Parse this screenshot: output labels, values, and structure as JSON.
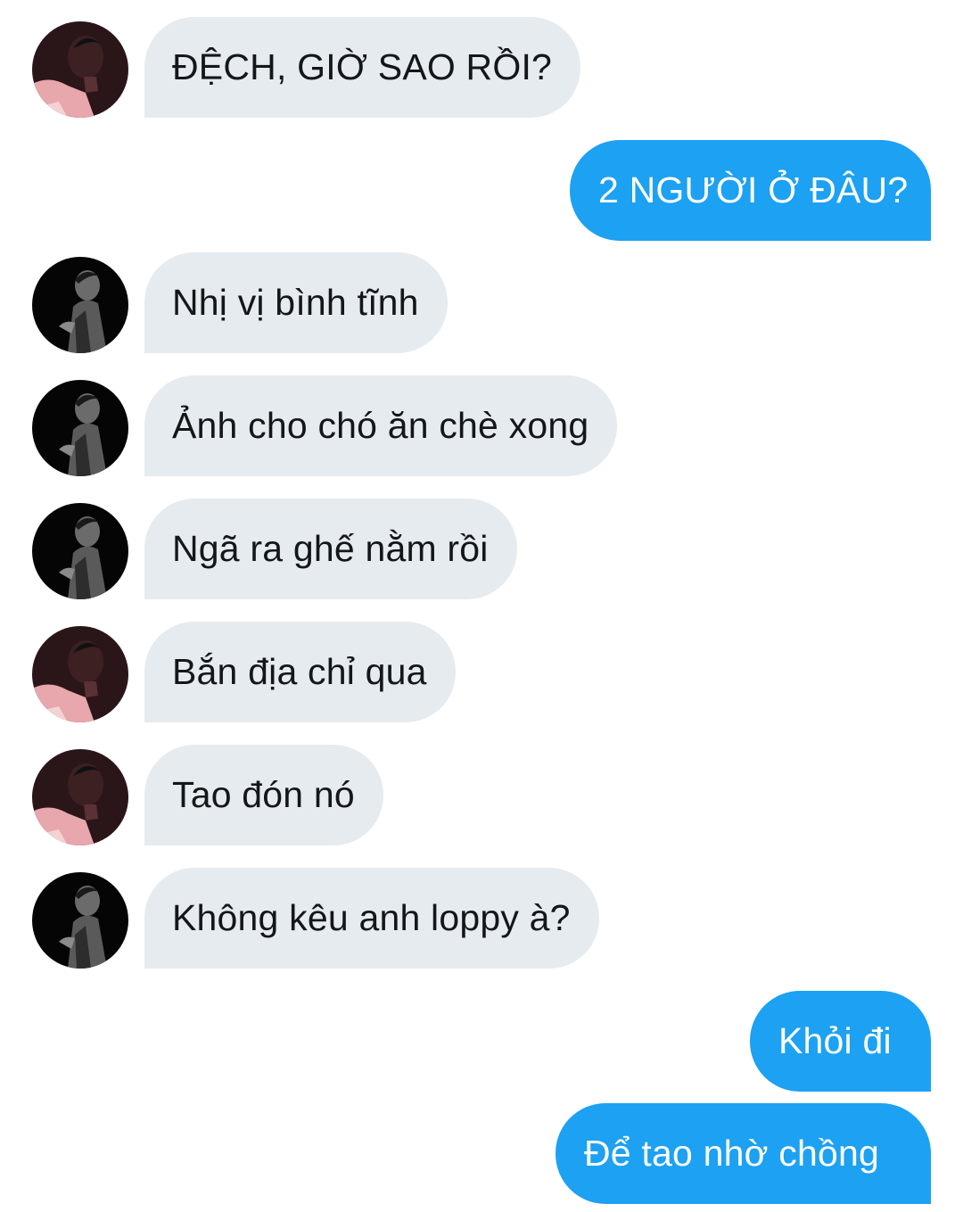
{
  "colors": {
    "incoming_bubble": "#e6ebf0",
    "outgoing_bubble": "#1da1f2",
    "incoming_text": "#14171a",
    "outgoing_text": "#ffffff"
  },
  "messages": [
    {
      "direction": "incoming",
      "avatar": "avatar-profile-pink",
      "text": "ĐỆCH, GIỜ SAO RỒI?"
    },
    {
      "direction": "outgoing",
      "text": "2 NGƯỜI Ở ĐÂU?"
    },
    {
      "direction": "incoming",
      "avatar": "avatar-profile-dark",
      "text": "Nhị vị bình tĩnh"
    },
    {
      "direction": "incoming",
      "avatar": "avatar-profile-dark",
      "text": "Ảnh cho chó ăn chè xong"
    },
    {
      "direction": "incoming",
      "avatar": "avatar-profile-dark",
      "text": "Ngã ra ghế nằm rồi"
    },
    {
      "direction": "incoming",
      "avatar": "avatar-profile-pink",
      "text": "Bắn địa chỉ qua"
    },
    {
      "direction": "incoming",
      "avatar": "avatar-profile-pink",
      "text": "Tao đón nó"
    },
    {
      "direction": "incoming",
      "avatar": "avatar-profile-dark",
      "text": "Không kêu anh loppy à?"
    },
    {
      "direction": "outgoing",
      "text": "Khỏi đi"
    },
    {
      "direction": "outgoing",
      "text": "Để tao nhờ chồng"
    }
  ]
}
